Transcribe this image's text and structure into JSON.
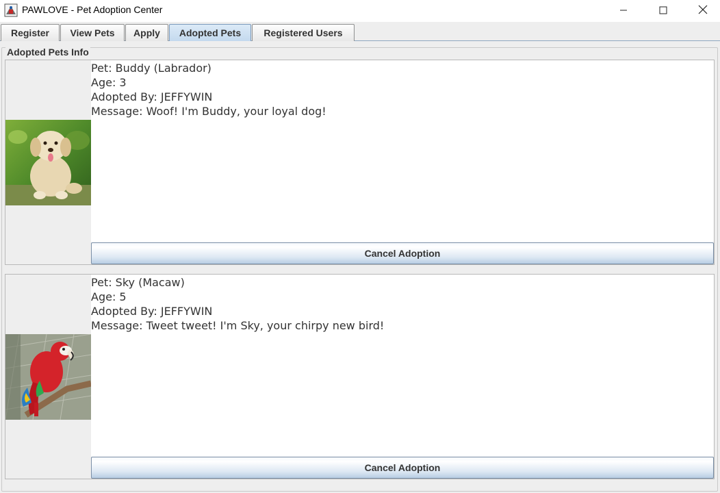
{
  "window": {
    "title": "PAWLOVE - Pet Adoption Center",
    "icon": "app-java-icon",
    "controls": [
      "minimize-icon",
      "maximize-icon",
      "close-icon"
    ]
  },
  "tabs": [
    {
      "label": "Register",
      "active": false
    },
    {
      "label": "View Pets",
      "active": false
    },
    {
      "label": "Apply",
      "active": false
    },
    {
      "label": "Adopted Pets",
      "active": true
    },
    {
      "label": "Registered Users",
      "active": false
    }
  ],
  "panel": {
    "title": "Adopted Pets Info"
  },
  "pets": [
    {
      "pet_line": "Pet: Buddy (Labrador)",
      "age_line": "Age: 3",
      "adopted_by_line": "Adopted By: JEFFYWIN",
      "message_line": "Message: Woof! I'm Buddy, your loyal dog!",
      "image": "labrador-puppy-photo",
      "button_label": "Cancel Adoption"
    },
    {
      "pet_line": "Pet: Sky (Macaw)",
      "age_line": "Age: 5",
      "adopted_by_line": "Adopted By: JEFFYWIN",
      "message_line": "Message: Tweet tweet! I'm Sky, your chirpy new bird!",
      "image": "macaw-parrot-photo",
      "button_label": "Cancel Adoption"
    }
  ],
  "colors": {
    "active_tab": "#c4d9ee",
    "background": "#eeeeee",
    "button_bottom": "#b8cde3"
  }
}
